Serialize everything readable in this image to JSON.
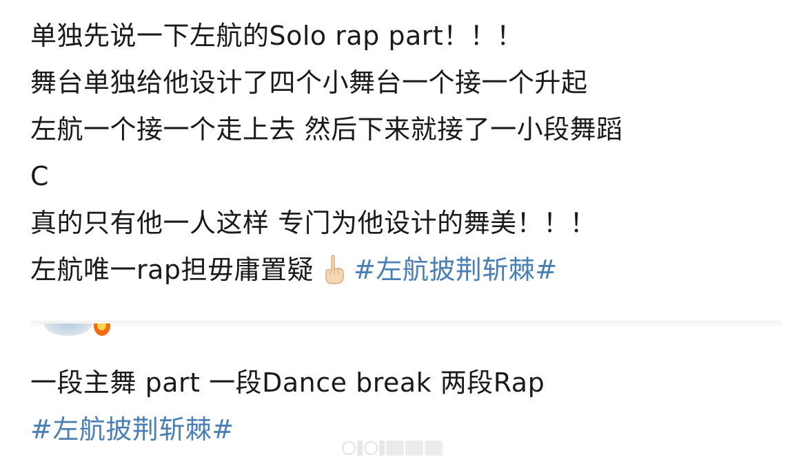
{
  "post": {
    "lines": [
      "单独先说一下左航的Solo rap part！！！",
      "舞台单独给他设计了四个小舞台一个接一个升起",
      "左航一个接一个走上去 然后下来就接了一小段舞蹈",
      "C",
      "真的只有他一人这样 专门为他设计的舞美！！！"
    ],
    "last_line_text": "左航唯一rap担毋庸置疑",
    "last_line_emoji": "pointing-up-emoji",
    "last_line_hashtag": "#左航披荆斩棘#"
  },
  "reply": {
    "text": "一段主舞 part 一段Dance break 两段Rap",
    "hashtag": "#左航披荆斩棘#"
  },
  "colors": {
    "text": "#1a1a1a",
    "hashtag": "#4a7fb5",
    "background": "#ffffff"
  }
}
